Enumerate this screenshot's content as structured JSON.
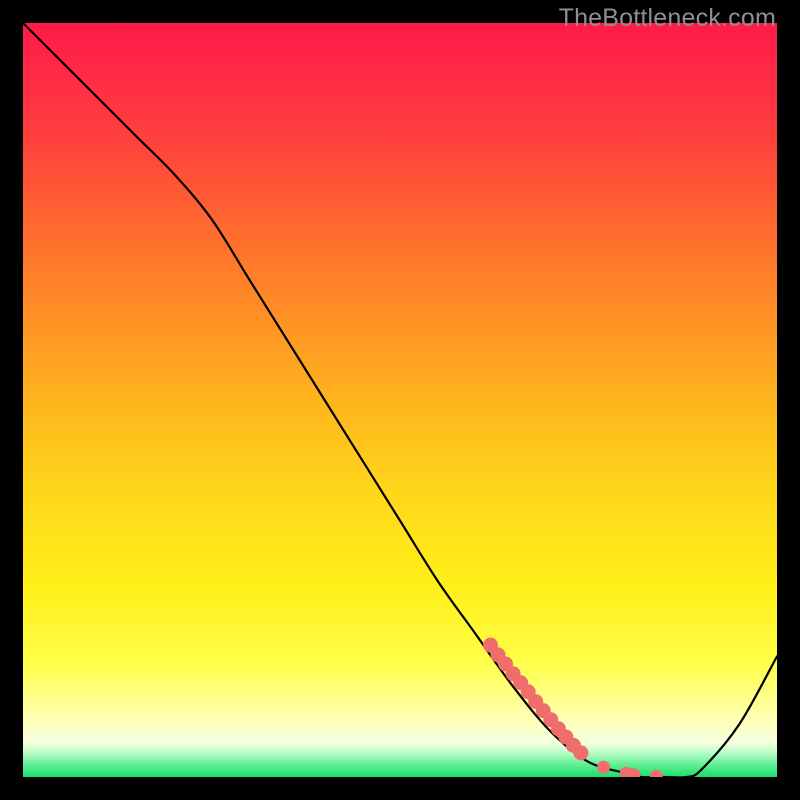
{
  "watermark": "TheBottleneck.com",
  "colors": {
    "gradient_top": "#ff1a49",
    "gradient_mid_upper": "#ff7a2a",
    "gradient_mid": "#ffd61a",
    "gradient_mid_lower": "#ffff4a",
    "gradient_pale": "#ffffd0",
    "gradient_bottom": "#18e06a",
    "curve": "#000000",
    "marker_fill": "#ef6e6b",
    "marker_stroke": "#d94f4c"
  },
  "chart_data": {
    "type": "line",
    "title": "",
    "xlabel": "",
    "ylabel": "",
    "xlim": [
      0,
      100
    ],
    "ylim": [
      0,
      100
    ],
    "series": [
      {
        "name": "bottleneck-curve",
        "x": [
          0,
          5,
          10,
          15,
          20,
          25,
          30,
          35,
          40,
          45,
          50,
          55,
          60,
          65,
          70,
          75,
          80,
          82,
          85,
          88,
          90,
          95,
          100
        ],
        "y": [
          100,
          95,
          90,
          85,
          80,
          74,
          66,
          58,
          50,
          42,
          34,
          26,
          19,
          12,
          6,
          2,
          0.5,
          0,
          0,
          0,
          1,
          7,
          16
        ]
      }
    ],
    "markers": {
      "name": "highlight-segment",
      "points": [
        {
          "x": 62,
          "y": 17.5
        },
        {
          "x": 63,
          "y": 16.2
        },
        {
          "x": 64,
          "y": 15.0
        },
        {
          "x": 65,
          "y": 13.7
        },
        {
          "x": 66,
          "y": 12.5
        },
        {
          "x": 67,
          "y": 11.3
        },
        {
          "x": 68,
          "y": 10.0
        },
        {
          "x": 69,
          "y": 8.8
        },
        {
          "x": 70,
          "y": 7.6
        },
        {
          "x": 71,
          "y": 6.4
        },
        {
          "x": 72,
          "y": 5.3
        },
        {
          "x": 73,
          "y": 4.2
        },
        {
          "x": 74,
          "y": 3.2
        },
        {
          "x": 77,
          "y": 1.3
        },
        {
          "x": 80,
          "y": 0.5
        },
        {
          "x": 81,
          "y": 0.3
        },
        {
          "x": 84,
          "y": 0.1
        }
      ]
    }
  }
}
